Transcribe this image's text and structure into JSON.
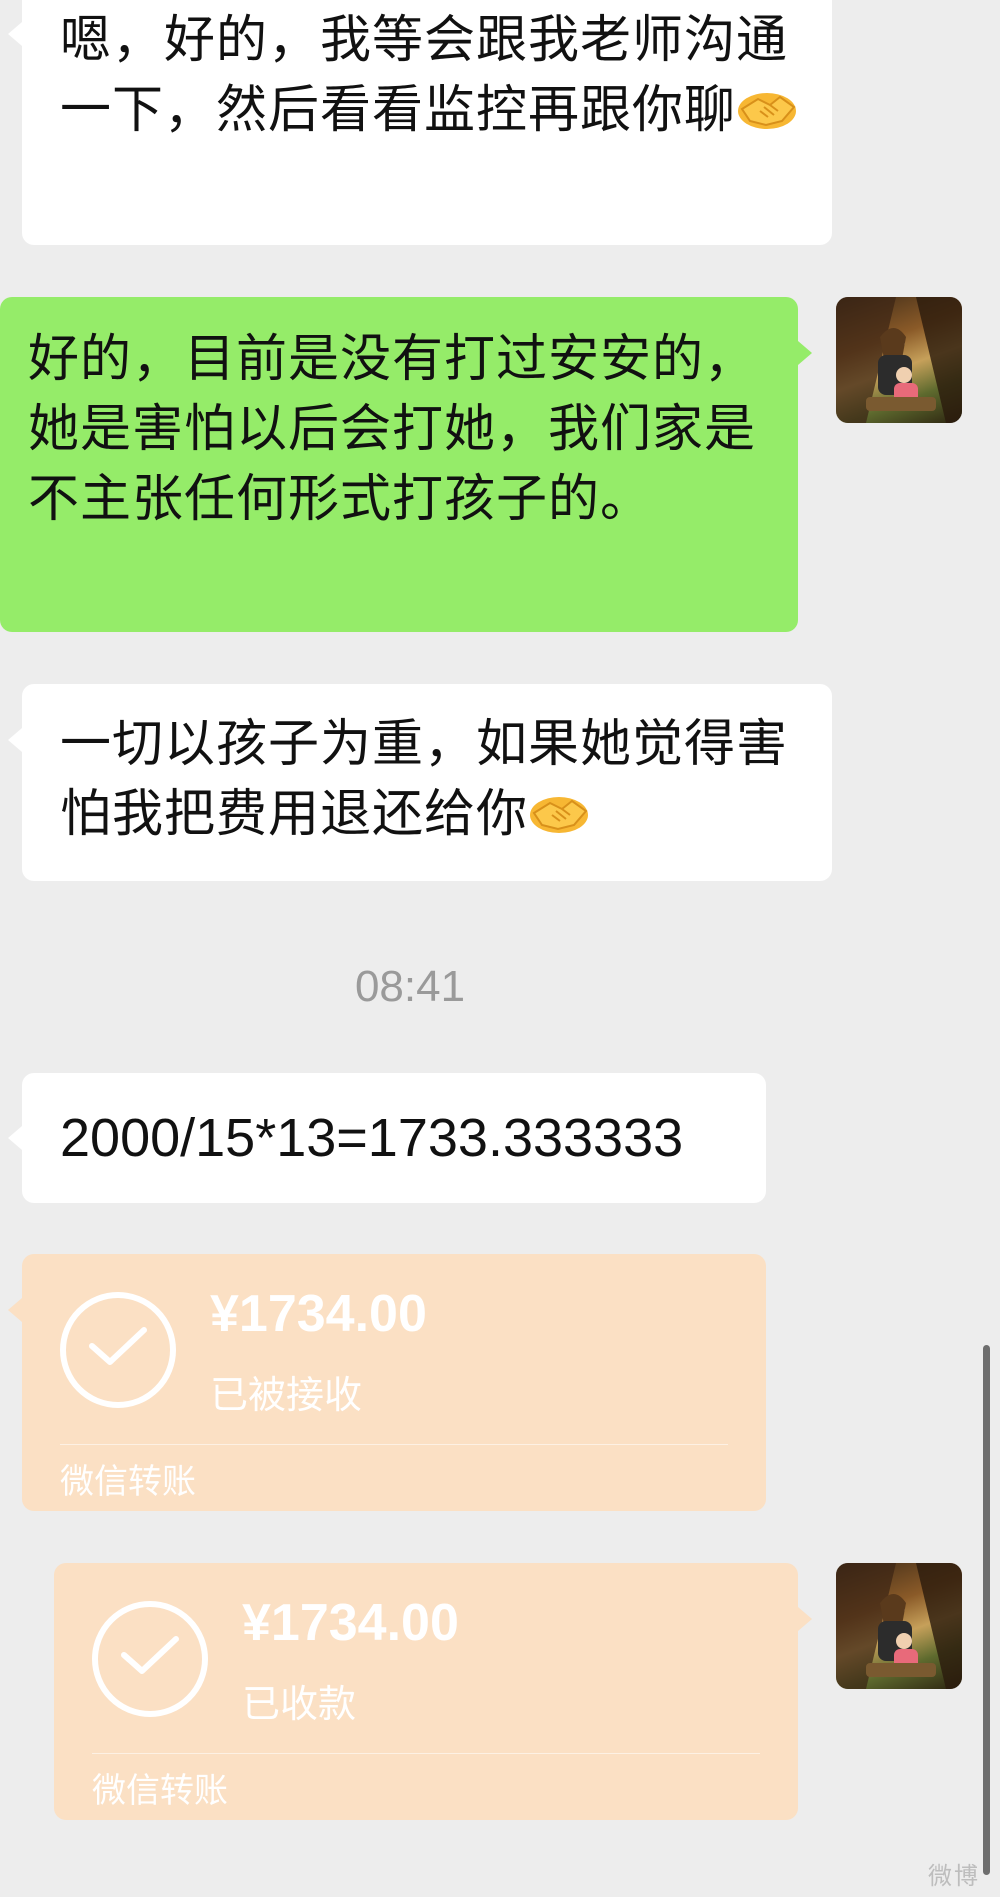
{
  "messages": [
    {
      "side": "left",
      "text": "嗯，好的，我等会跟我老师沟通一下，然后看看监控再跟你聊"
    },
    {
      "side": "right",
      "text": "好的，目前是没有打过安安的，她是害怕以后会打她，我们家是不主张任何形式打孩子的。"
    },
    {
      "side": "left",
      "text": "一切以孩子为重，如果她觉得害怕我把费用退还给你"
    },
    {
      "side": "left",
      "text": "2000/15*13=1733.333333"
    }
  ],
  "timestamp": "08:41",
  "transfers": [
    {
      "side": "left",
      "amount": "¥1734.00",
      "status": "已被接收",
      "brand": "微信转账"
    },
    {
      "side": "right",
      "amount": "¥1734.00",
      "status": "已收款",
      "brand": "微信转账"
    }
  ],
  "icons": {
    "emoji": "handshake-emoji",
    "check": "check-circle-icon"
  },
  "watermark": "微博",
  "colors": {
    "background": "#ededed",
    "sent_bubble": "#95ec69",
    "received_bubble": "#ffffff",
    "transfer": "#fbe0c4",
    "timestamp": "#9a9a9a"
  }
}
